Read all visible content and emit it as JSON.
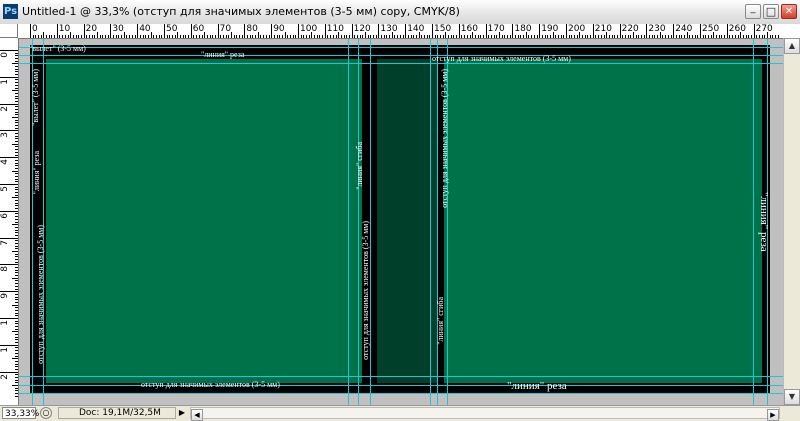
{
  "window": {
    "app_icon": "Ps",
    "title": "Untitled-1 @ 33,3% (отступ для значимых элементов (3-5 мм) copy, CMYK/8)"
  },
  "ruler_top": [
    "0",
    "10",
    "20",
    "30",
    "40",
    "50",
    "60",
    "70",
    "80",
    "90",
    "100",
    "110",
    "120",
    "130",
    "140",
    "150",
    "160",
    "170",
    "180",
    "190",
    "200",
    "210",
    "220",
    "230",
    "240",
    "250",
    "260",
    "270"
  ],
  "ruler_left": [
    "0",
    "1",
    "2",
    "3",
    "4",
    "5",
    "6",
    "7",
    "8",
    "9",
    "1",
    "1",
    "2"
  ],
  "canvas": {
    "labels": {
      "bleed_top_left": "\"вылет\" (3-5 мм)",
      "cut_top": "\"линия\" реза",
      "margin_top_right": "отступ для значимых элементов (3-5 мм)",
      "bleed_left_vertical": "\"вылет\" (3-5 мм)",
      "cut_left": "\"линия\" реза",
      "margin_left": "отступ для значимых элементов (3-5 мм)",
      "fold_spine": "\"линия\" сгиба",
      "margin_spine": "отступ для значимых элементов (3-5 мм)",
      "margin_front_left": "отступ для значимых элементов (3-5 мм)",
      "fold_front": "\"линия\" сгиба",
      "cut_right": "\"линия\" реза",
      "margin_bottom": "отступ для значимых элементов (3-5 мм)",
      "cut_bottom": "\"линия\" реза"
    },
    "colors": {
      "panel": "#00724a",
      "spine": "#00402a",
      "guide": "#18c8d8",
      "bleed": "#000000"
    }
  },
  "statusbar": {
    "zoom": "33,33%",
    "doc_info": "Doc: 19,1M/32,5M",
    "info_icon": "status-circle-icon",
    "menu_arrow": "▶"
  }
}
